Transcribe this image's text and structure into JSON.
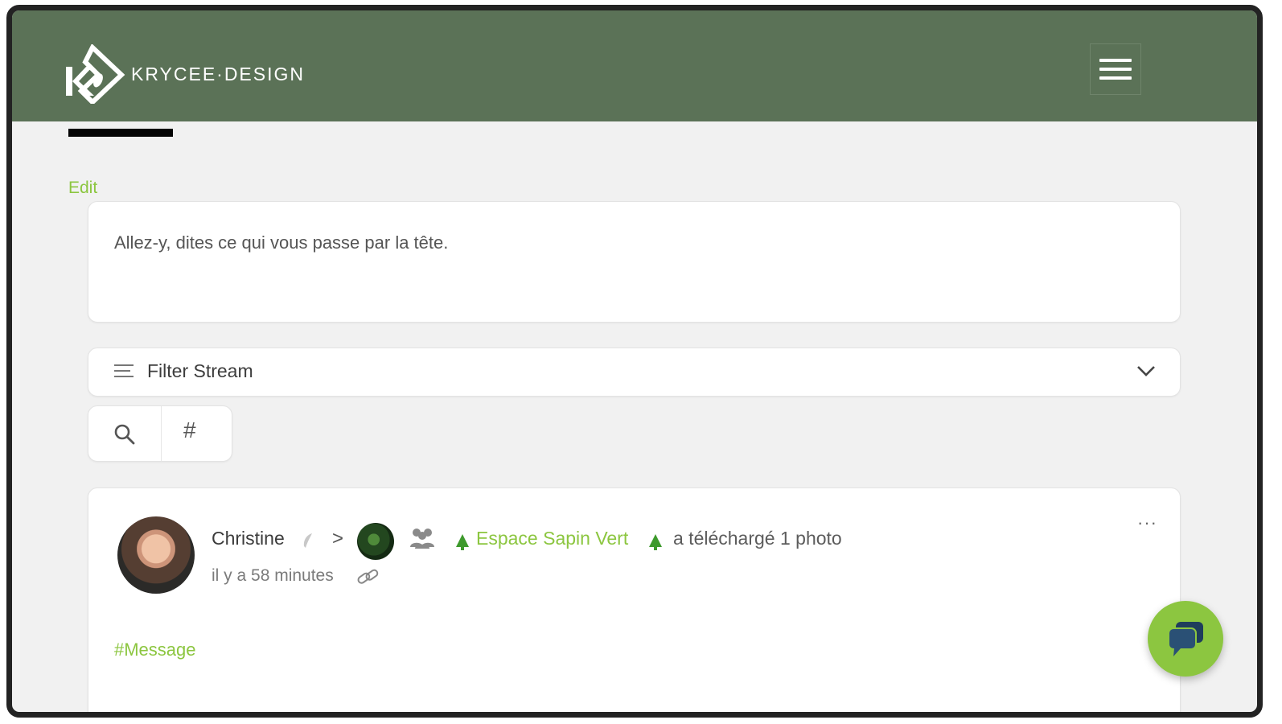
{
  "header": {
    "brand_name": "KRYCEE·DESIGN",
    "logo_icon": "kd-logo-icon",
    "menu_icon": "hamburger-menu-icon",
    "background_color": "#5b7257"
  },
  "edit_link": "Edit",
  "composer": {
    "placeholder": "Allez-y, dites ce qui vous passe par la tête."
  },
  "filter": {
    "label": "Filter Stream",
    "icon": "filter-lines-icon",
    "chevron_icon": "chevron-down-icon"
  },
  "search_tools": {
    "search_icon": "search-icon",
    "hashtag_label": "#"
  },
  "post": {
    "author": "Christine",
    "separator": ">",
    "space_name": "Espace Sapin Vert",
    "action_text": "a téléchargé 1 photo",
    "time_text": "il y a 58 minutes",
    "menu_label": "···",
    "hashtag": "#Message"
  },
  "colors": {
    "accent_green": "#8cc640",
    "header_green": "#5b7257",
    "page_background": "#f1f1f1"
  },
  "chat_button": {
    "icon": "chat-bubbles-icon"
  }
}
